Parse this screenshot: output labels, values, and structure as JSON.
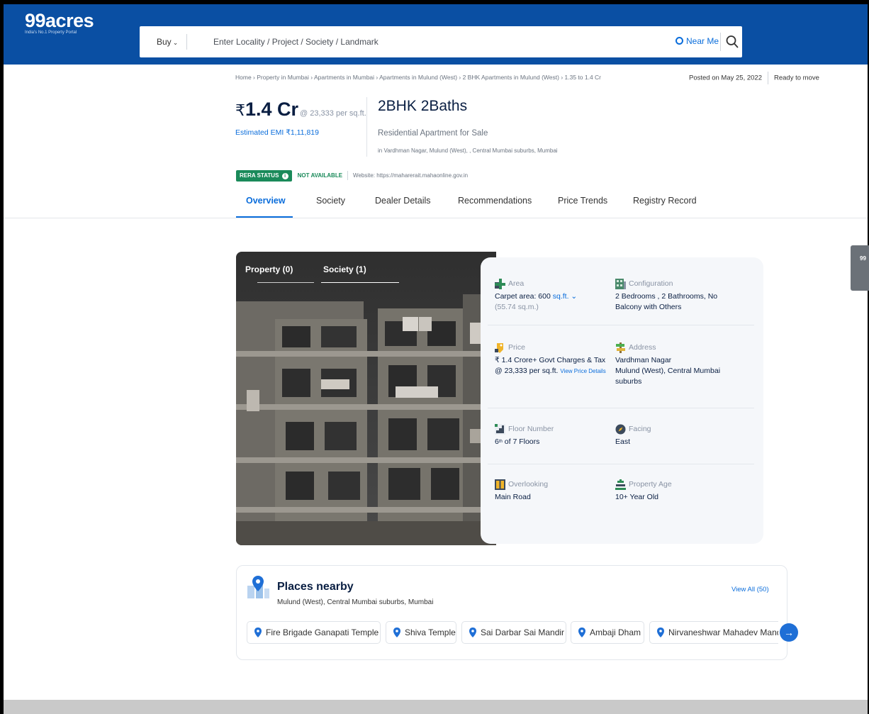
{
  "header": {
    "logo_name": "99acres",
    "logo_tagline": "India's No.1 Property Portal",
    "buy_label": "Buy",
    "search_placeholder": "Enter Locality / Project / Society / Landmark",
    "near_me_label": "Near Me",
    "colors": {
      "bar": "#0a4fa3",
      "accent": "#0a6ddb"
    }
  },
  "breadcrumb": "Home › Property in Mumbai › Apartments in Mumbai › Apartments in Mulund (West) › 2 BHK Apartments in Mulund (West) › 1.35 to 1.4 Cr",
  "posted": {
    "date": "Posted on May 25, 2022",
    "status": "Ready to move"
  },
  "listing": {
    "currency": "₹",
    "price": "1.4 Cr",
    "per_sqft": "@ 23,333 per sq.ft.",
    "emi": "Estimated EMI ₹1,11,819",
    "title": "2BHK 2Baths",
    "subtitle": "Residential Apartment for Sale",
    "location": "in Vardhman Nagar, Mulund (West), , Central Mumbai suburbs, Mumbai"
  },
  "rera": {
    "badge": "RERA STATUS",
    "info_glyph": "i",
    "status": "NOT AVAILABLE",
    "website": "Website: https://maharerait.mahaonline.gov.in",
    "color": "#1a8a5a"
  },
  "tabs": [
    {
      "label": "Overview",
      "active": true
    },
    {
      "label": "Society",
      "active": false
    },
    {
      "label": "Dealer Details",
      "active": false
    },
    {
      "label": "Recommendations",
      "active": false
    },
    {
      "label": "Price Trends",
      "active": false
    },
    {
      "label": "Registry Record",
      "active": false
    }
  ],
  "gallery": {
    "tabs": [
      "Property (0)",
      "Society (1)"
    ]
  },
  "details": {
    "area": {
      "label": "Area",
      "value": "Carpet area: 600",
      "unit": "sq.ft.",
      "sub": "(55.74 sq.m.)"
    },
    "configuration": {
      "label": "Configuration",
      "line1": "2 Bedrooms , 2 Bathrooms, No",
      "line2": "Balcony with Others"
    },
    "price": {
      "label": "Price",
      "line1": "₹ 1.4 Crore+ Govt Charges & Tax",
      "line2": "@ 23,333 per sq.ft.",
      "link": "View Price Details"
    },
    "address": {
      "label": "Address",
      "line1": "Vardhman Nagar",
      "line2": "Mulund (West), Central Mumbai",
      "line3": "suburbs"
    },
    "floor": {
      "label": "Floor Number",
      "num": "6",
      "sup": "th",
      "rest": "of 7 Floors"
    },
    "facing": {
      "label": "Facing",
      "value": "East"
    },
    "overlooking": {
      "label": "Overlooking",
      "value": "Main Road"
    },
    "age": {
      "label": "Property Age",
      "value": "10+ Year Old"
    }
  },
  "side_widget": {
    "text": "99"
  },
  "places": {
    "title": "Places nearby",
    "subtitle": "Mulund (West), Central Mumbai suburbs, Mumbai",
    "view_all": "View All (50)",
    "items": [
      "Fire Brigade Ganapati Temple",
      "Shiva Temple",
      "Sai Darbar Sai Mandir",
      "Ambaji Dham",
      "Nirvaneshwar Mahadev Mandir"
    ],
    "next_glyph": "→"
  }
}
